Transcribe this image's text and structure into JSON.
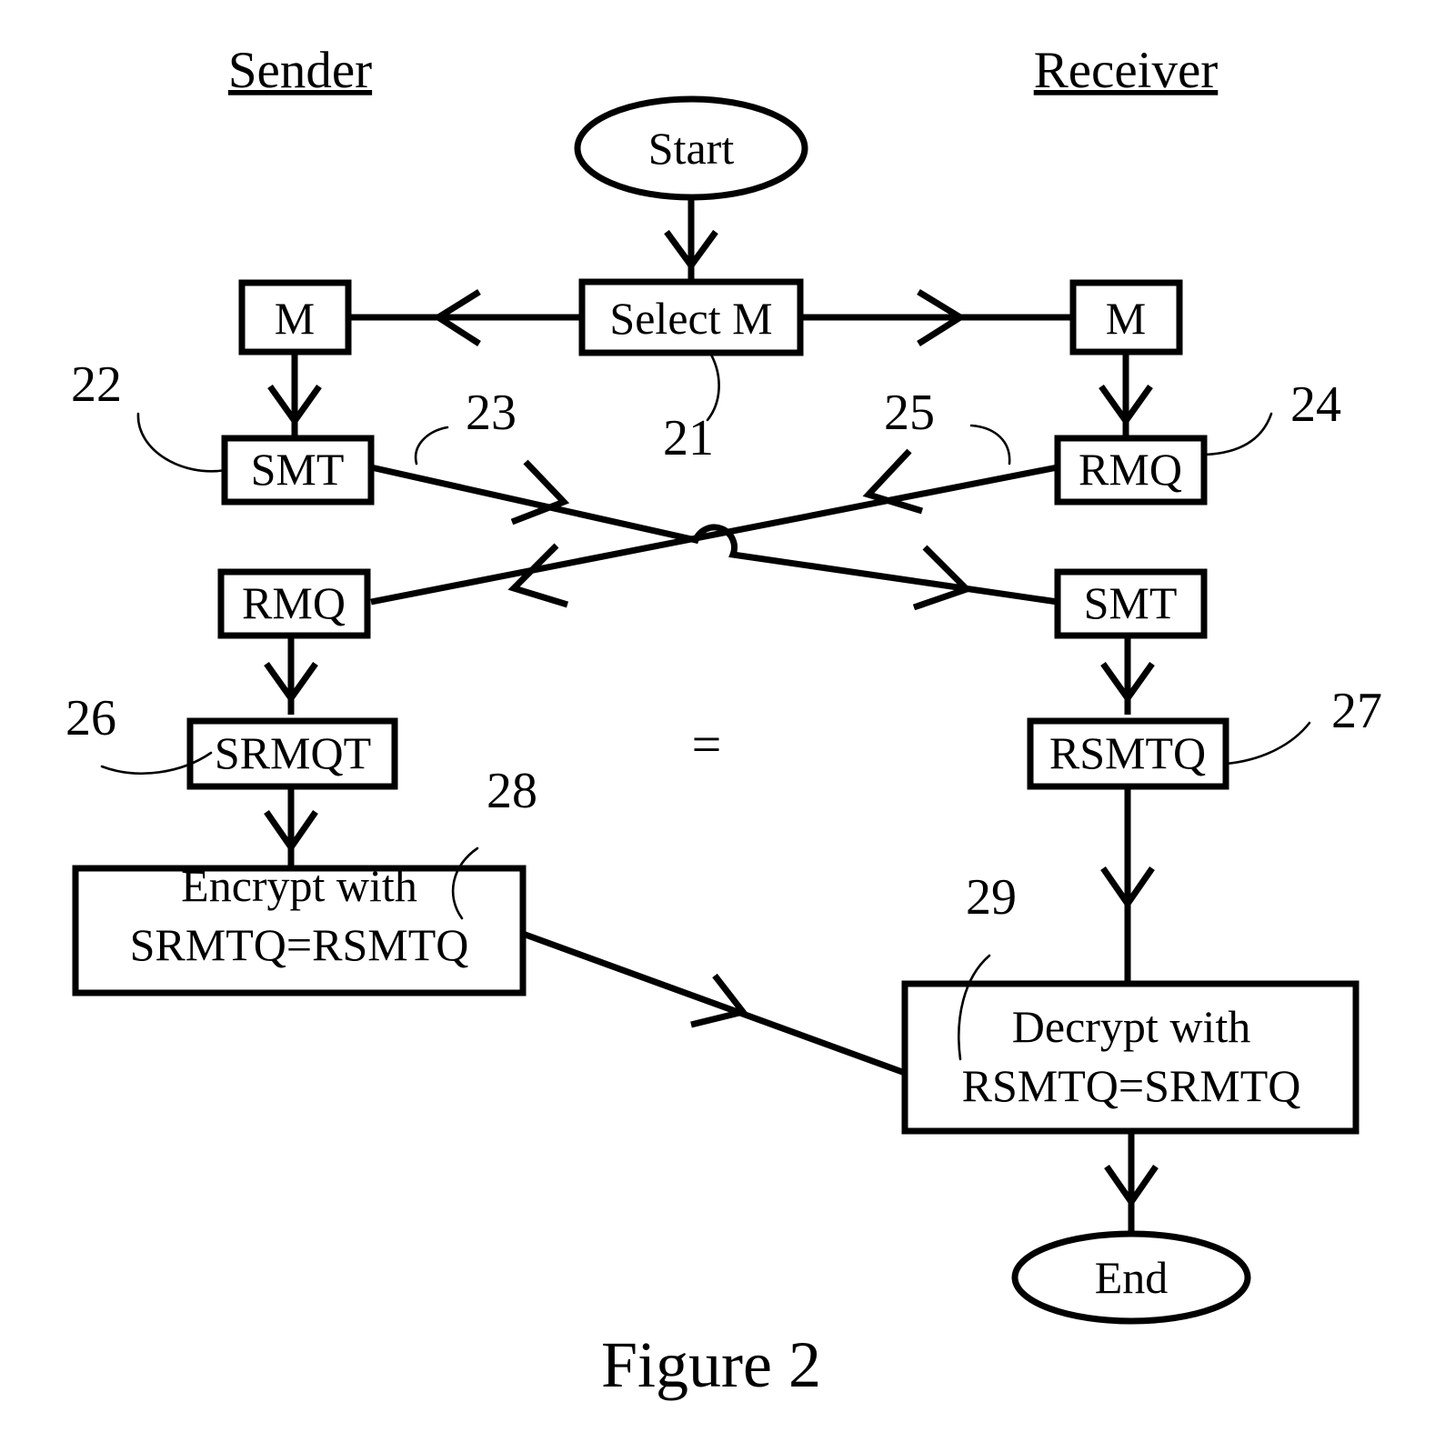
{
  "figure": {
    "caption": "Figure 2",
    "columns": {
      "left_heading": "Sender",
      "right_heading": "Receiver"
    },
    "stroke_color": "#000000",
    "background_color": "#ffffff"
  },
  "nodes": {
    "start": {
      "label": "Start",
      "shape": "ellipse"
    },
    "end": {
      "label": "End",
      "shape": "ellipse"
    },
    "select_m": {
      "label": "Select M",
      "shape": "rect"
    },
    "sender_m": {
      "label": "M",
      "shape": "rect"
    },
    "receiver_m": {
      "label": "M",
      "shape": "rect"
    },
    "sender_smt": {
      "label": "SMT",
      "shape": "rect"
    },
    "receiver_rmq": {
      "label": "RMQ",
      "shape": "rect"
    },
    "sender_rmq": {
      "label": "RMQ",
      "shape": "rect"
    },
    "receiver_smt": {
      "label": "SMT",
      "shape": "rect"
    },
    "sender_srmqt": {
      "label": "SRMQT",
      "shape": "rect"
    },
    "receiver_rsmtq": {
      "label": "RSMTQ",
      "shape": "rect"
    },
    "encrypt": {
      "line1": "Encrypt with",
      "line2": "SRMTQ=RSMTQ",
      "shape": "rect"
    },
    "decrypt": {
      "line1": "Decrypt with",
      "line2": "RSMTQ=SRMTQ",
      "shape": "rect"
    }
  },
  "equivalence_marker": "=",
  "reference_numerals": [
    {
      "id": "ref-21",
      "value": "21",
      "points_to": "select_m"
    },
    {
      "id": "ref-22",
      "value": "22",
      "points_to": "sender_smt"
    },
    {
      "id": "ref-23",
      "value": "23",
      "points_to": "smt-to-smt-line"
    },
    {
      "id": "ref-24",
      "value": "24",
      "points_to": "receiver_rmq"
    },
    {
      "id": "ref-25",
      "value": "25",
      "points_to": "rmq-to-rmq-line"
    },
    {
      "id": "ref-26",
      "value": "26",
      "points_to": "sender_srmqt"
    },
    {
      "id": "ref-27",
      "value": "27",
      "points_to": "receiver_rsmtq"
    },
    {
      "id": "ref-28",
      "value": "28",
      "points_to": "encrypt"
    },
    {
      "id": "ref-29",
      "value": "29",
      "points_to": "decrypt"
    }
  ]
}
